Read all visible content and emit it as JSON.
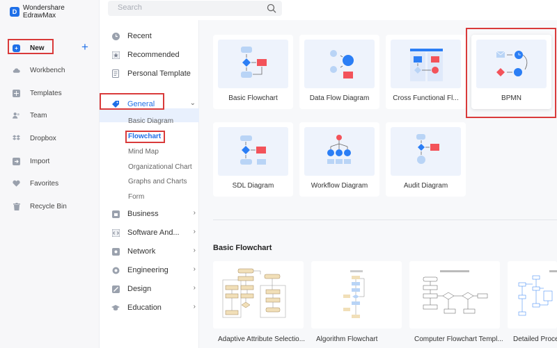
{
  "app": {
    "name": "Wondershare EdrawMax"
  },
  "search": {
    "placeholder": "Search"
  },
  "sidebar": {
    "items": [
      {
        "label": "New",
        "icon": "new-icon"
      },
      {
        "label": "Workbench",
        "icon": "cloud-icon"
      },
      {
        "label": "Templates",
        "icon": "templates-icon"
      },
      {
        "label": "Team",
        "icon": "team-icon"
      },
      {
        "label": "Dropbox",
        "icon": "dropbox-icon"
      },
      {
        "label": "Import",
        "icon": "import-icon"
      },
      {
        "label": "Favorites",
        "icon": "heart-icon"
      },
      {
        "label": "Recycle Bin",
        "icon": "trash-icon"
      }
    ]
  },
  "categories": {
    "top": [
      {
        "label": "Recent",
        "icon": "clock-icon"
      },
      {
        "label": "Recommended",
        "icon": "star-icon"
      },
      {
        "label": "Personal Template",
        "icon": "document-icon"
      }
    ],
    "general": {
      "label": "General",
      "icon": "tag-icon"
    },
    "general_sub": [
      "Basic Diagram",
      "Flowchart",
      "Mind Map",
      "Organizational Chart",
      "Graphs and Charts",
      "Form"
    ],
    "groups": [
      {
        "label": "Business",
        "icon": "business-icon"
      },
      {
        "label": "Software And...",
        "icon": "software-icon"
      },
      {
        "label": "Network",
        "icon": "network-icon"
      },
      {
        "label": "Engineering",
        "icon": "engineering-icon"
      },
      {
        "label": "Design",
        "icon": "design-icon"
      },
      {
        "label": "Education",
        "icon": "education-icon"
      }
    ]
  },
  "diagram_types": [
    {
      "label": "Basic Flowchart"
    },
    {
      "label": "Data Flow Diagram"
    },
    {
      "label": "Cross Functional Fl..."
    },
    {
      "label": "BPMN"
    },
    {
      "label": "SDL Diagram"
    },
    {
      "label": "Workflow Diagram"
    },
    {
      "label": "Audit Diagram"
    }
  ],
  "templates": {
    "title": "Basic Flowchart",
    "items": [
      {
        "label": "Adaptive Attribute Selectio..."
      },
      {
        "label": "Algorithm Flowchart"
      },
      {
        "label": "Computer Flowchart Templ..."
      },
      {
        "label": "Detailed Proce..."
      }
    ]
  },
  "colors": {
    "accent": "#1e6fe8",
    "highlight": "#d93a3a",
    "shape_blue": "#2b7ef5",
    "shape_red": "#f3535a",
    "shape_light": "#b9d4f6"
  }
}
